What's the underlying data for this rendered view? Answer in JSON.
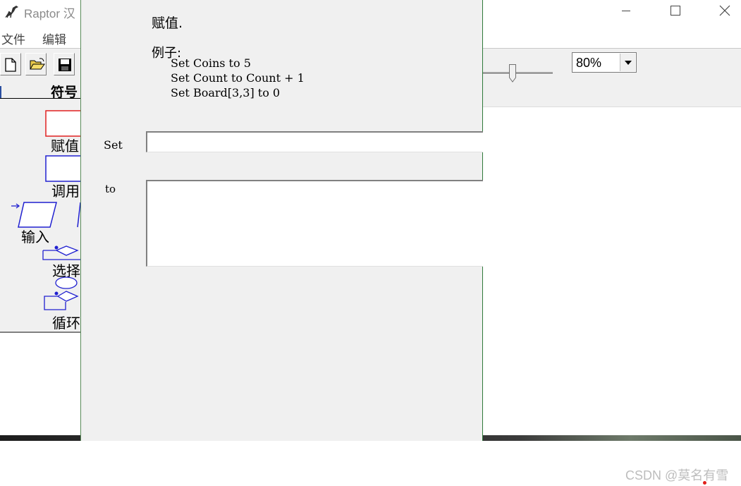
{
  "window": {
    "title": "Raptor 汉",
    "menu": {
      "file": "文件",
      "edit": "编辑"
    }
  },
  "toolbar": {
    "buttons": [
      "new-file-icon",
      "open-folder-icon",
      "save-disk-icon"
    ],
    "zoom": {
      "selected": "80%"
    }
  },
  "symbols": {
    "header": "符号",
    "items": [
      {
        "label": "赋值",
        "icon": "assignment-rect-icon",
        "color": "#e02020"
      },
      {
        "label": "调用",
        "icon": "call-rect-icon",
        "color": "#2020d0"
      },
      {
        "label": "输入",
        "icon": "input-parallelogram-icon",
        "color": "#2020d0"
      },
      {
        "label": "选择",
        "icon": "selection-diamond-icon",
        "color": "#2020d0"
      },
      {
        "label": "循环",
        "icon": "loop-icon",
        "color": "#2020d0"
      }
    ]
  },
  "dialog": {
    "title": "赋值.",
    "example_label": "例子:",
    "examples": [
      "Set Coins to 5",
      "Set Count to Count + 1",
      "Set Board[3,3] to 0"
    ],
    "set_label": "Set",
    "to_label": "to",
    "set_value": "",
    "to_value": ""
  },
  "watermark": "CSDN @莫名有雪"
}
